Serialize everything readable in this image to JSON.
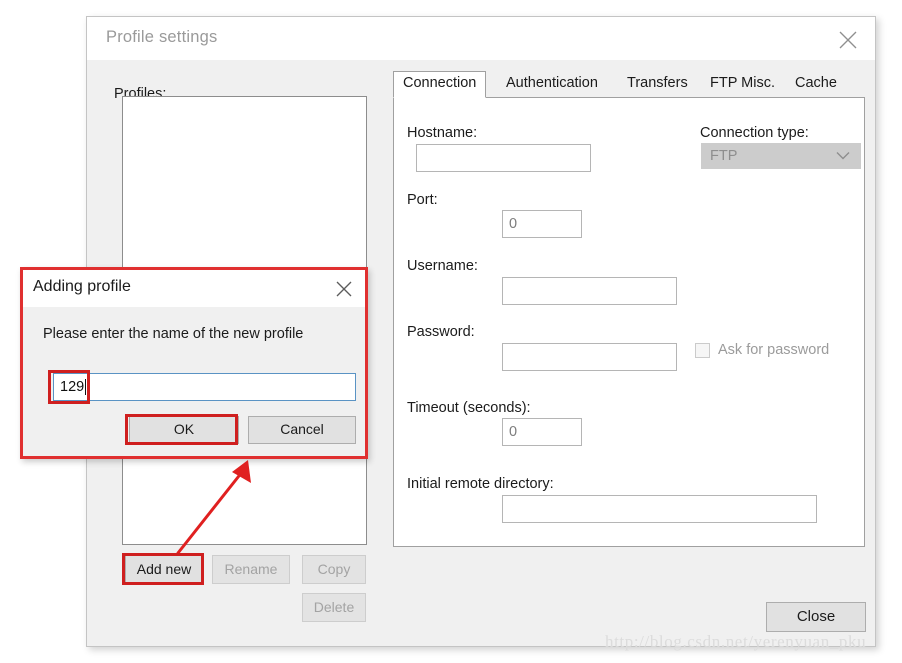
{
  "window": {
    "title": "Profile settings",
    "close_icon": "close-icon"
  },
  "profiles_panel": {
    "label": "Profiles:",
    "items": [],
    "buttons": {
      "add_new": "Add new",
      "rename": "Rename",
      "copy": "Copy",
      "delete": "Delete"
    }
  },
  "tabs": [
    {
      "label": "Connection",
      "active": true
    },
    {
      "label": "Authentication",
      "active": false
    },
    {
      "label": "Transfers",
      "active": false
    },
    {
      "label": "FTP Misc.",
      "active": false
    },
    {
      "label": "Cache",
      "active": false
    }
  ],
  "connection_tab": {
    "hostname": {
      "label": "Hostname:",
      "value": "",
      "placeholder": ""
    },
    "connection_type": {
      "label": "Connection type:",
      "selected": "FTP",
      "options": [
        "FTP"
      ],
      "chevron_icon": "chevron-down-icon",
      "disabled": true
    },
    "port": {
      "label": "Port:",
      "value": "0"
    },
    "username": {
      "label": "Username:",
      "value": ""
    },
    "password": {
      "label": "Password:",
      "value": ""
    },
    "ask_for_password": {
      "label": "Ask for password",
      "checked": false,
      "disabled": true
    },
    "timeout": {
      "label": "Timeout (seconds):",
      "value": "0"
    },
    "initial_remote_directory": {
      "label": "Initial remote directory:",
      "value": ""
    }
  },
  "footer": {
    "close_button": "Close"
  },
  "modal": {
    "title": "Adding profile",
    "close_icon": "close-icon",
    "prompt": "Please enter the name of the new profile",
    "name_input": {
      "value": "129",
      "placeholder": ""
    },
    "ok_button": "OK",
    "cancel_button": "Cancel"
  },
  "annotations": {
    "highlight_color": "#cf1f1f",
    "arrow_color": "#e02020",
    "boxes": [
      "name-input",
      "ok-button",
      "add-new-button"
    ],
    "arrow": "points-from-add-new-to-dialog"
  },
  "watermark": {
    "text": "http://blog.csdn.net/yerenyuan_pku"
  }
}
